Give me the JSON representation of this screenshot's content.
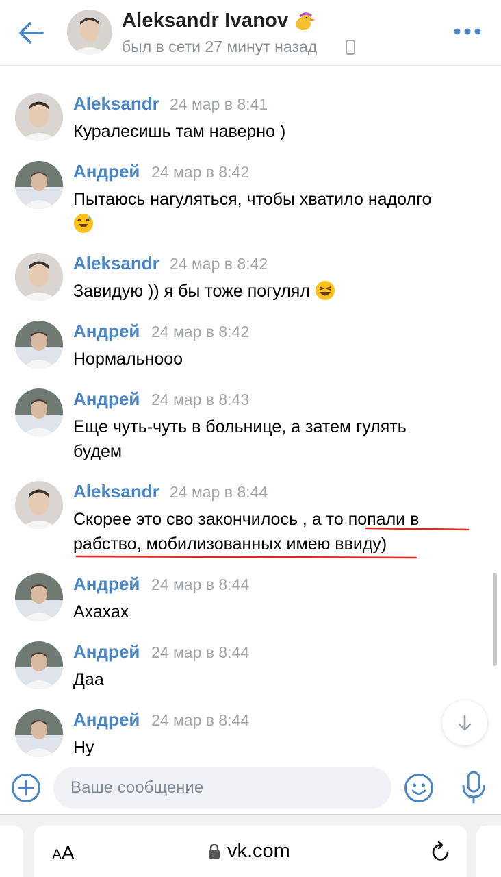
{
  "header": {
    "name": "Aleksandr Ivanov",
    "status": "был в сети 27 минут назад",
    "icons": {
      "back": "back-arrow-icon",
      "more": "more-dots-icon",
      "status": "phone-icon"
    }
  },
  "colors": {
    "accent": "#4a86c5",
    "time": "#a1a6ad",
    "input_bg": "#f0f2f5",
    "underline": "#e0271f"
  },
  "messages": [
    {
      "author": "Aleksandr",
      "time": "24 мар в 8:41",
      "text": "Куралесишь там наверно )"
    },
    {
      "author": "Андрей",
      "time": "24 мар в 8:42",
      "text": "Пытаюсь нагуляться, чтобы хватило надолго"
    },
    {
      "author": "Aleksandr",
      "time": "24 мар в 8:42",
      "text": "Завидую )) я бы тоже погулял"
    },
    {
      "author": "Андрей",
      "time": "24 мар в 8:42",
      "text": "Нормальнооо"
    },
    {
      "author": "Андрей",
      "time": "24 мар в 8:43",
      "text": "Еще чуть-чуть в больнице, а затем гулять будем"
    },
    {
      "author": "Aleksandr",
      "time": "24 мар в 8:44",
      "text": "Скорее это сво закончилось , а то попали в рабство, мобилизованных имею ввиду)"
    },
    {
      "author": "Андрей",
      "time": "24 мар в 8:44",
      "text": "Ахахах"
    },
    {
      "author": "Андрей",
      "time": "24 мар в 8:44",
      "text": "Даа"
    },
    {
      "author": "Андрей",
      "time": "24 мар в 8:44",
      "text": "Ну"
    }
  ],
  "composer": {
    "placeholder": "Ваше сообщение"
  },
  "browser": {
    "aa_big": "A",
    "aa_small": "A",
    "url": "vk.com"
  }
}
